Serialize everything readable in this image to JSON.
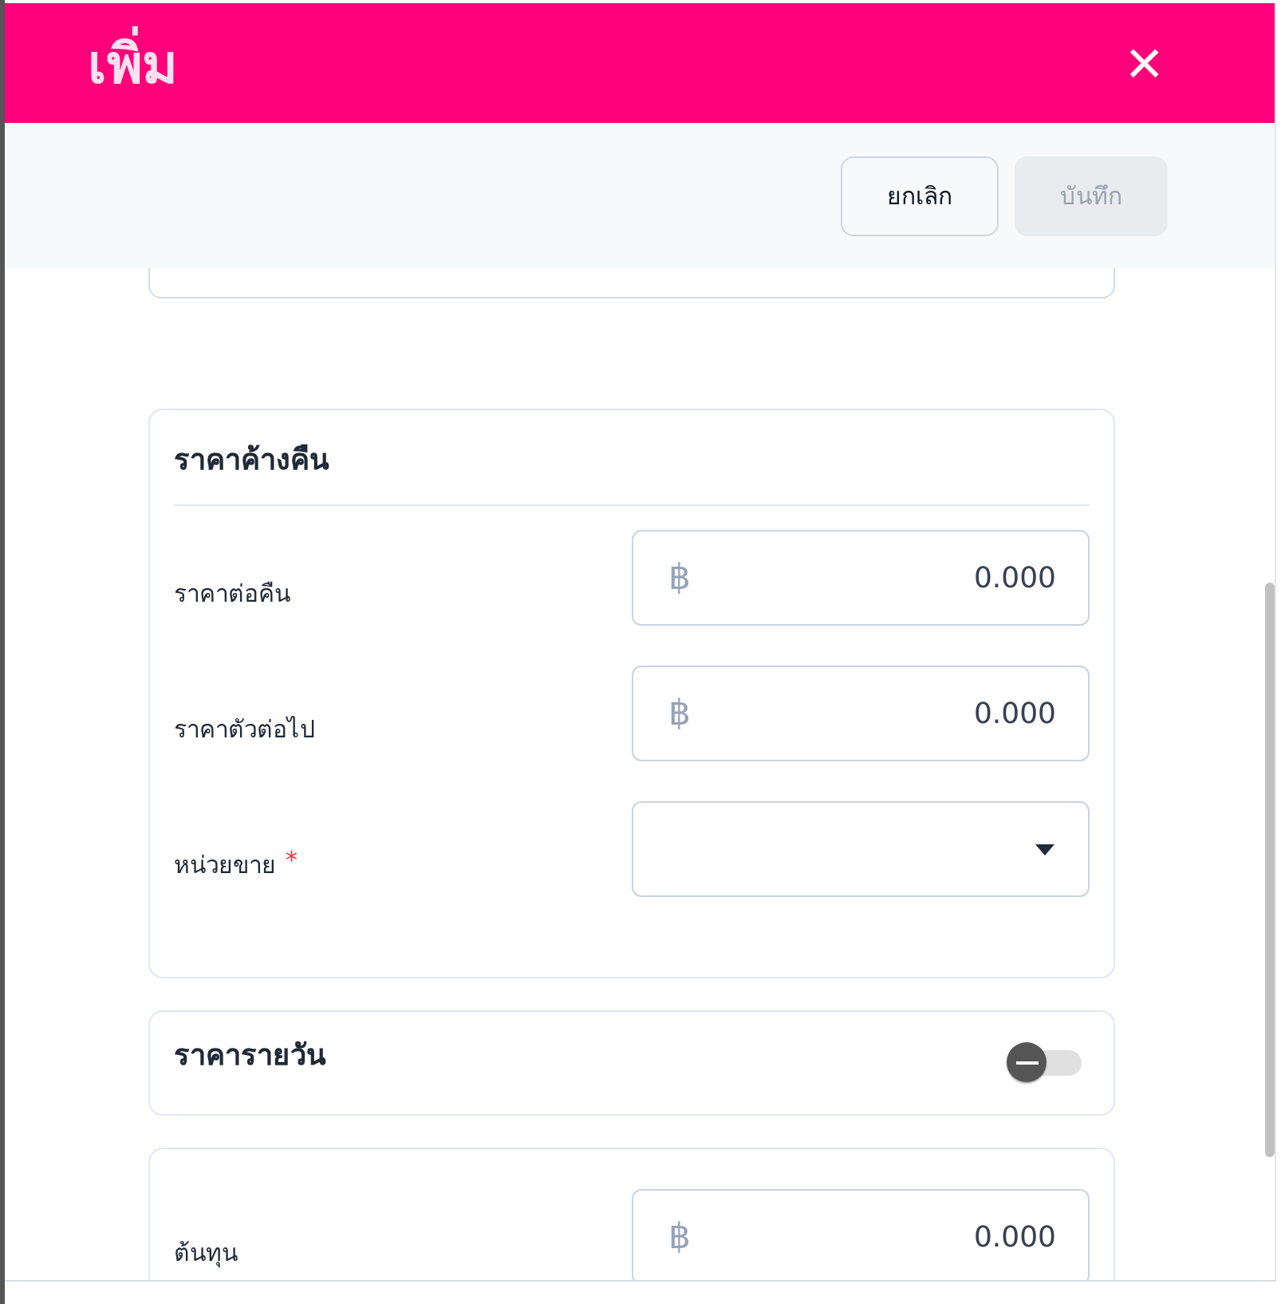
{
  "dialog": {
    "title": "เพิ่ม",
    "close": "×"
  },
  "toolbar": {
    "buttons": [
      {
        "label": "ยกเลิก",
        "disabled": false
      },
      {
        "label": "บันทึก",
        "disabled": true
      }
    ]
  },
  "sections": [
    {
      "kind": "fields",
      "title": "ราคาค้างคืน",
      "fields": [
        {
          "kind": "money",
          "label": "ราคาต่อคืน",
          "currency": "฿",
          "value": "0.000"
        },
        {
          "kind": "money",
          "label": "ราคาตัวต่อไป",
          "currency": "฿",
          "value": "0.000"
        },
        {
          "kind": "select",
          "label": "หน่วยขาย",
          "required_mark": "*"
        }
      ]
    },
    {
      "kind": "toggle",
      "title": "ราคารายวัน",
      "on": false
    },
    {
      "kind": "fields",
      "fields": [
        {
          "kind": "money",
          "label": "ต้นทุน",
          "currency": "฿",
          "value": "0.000"
        }
      ]
    }
  ]
}
